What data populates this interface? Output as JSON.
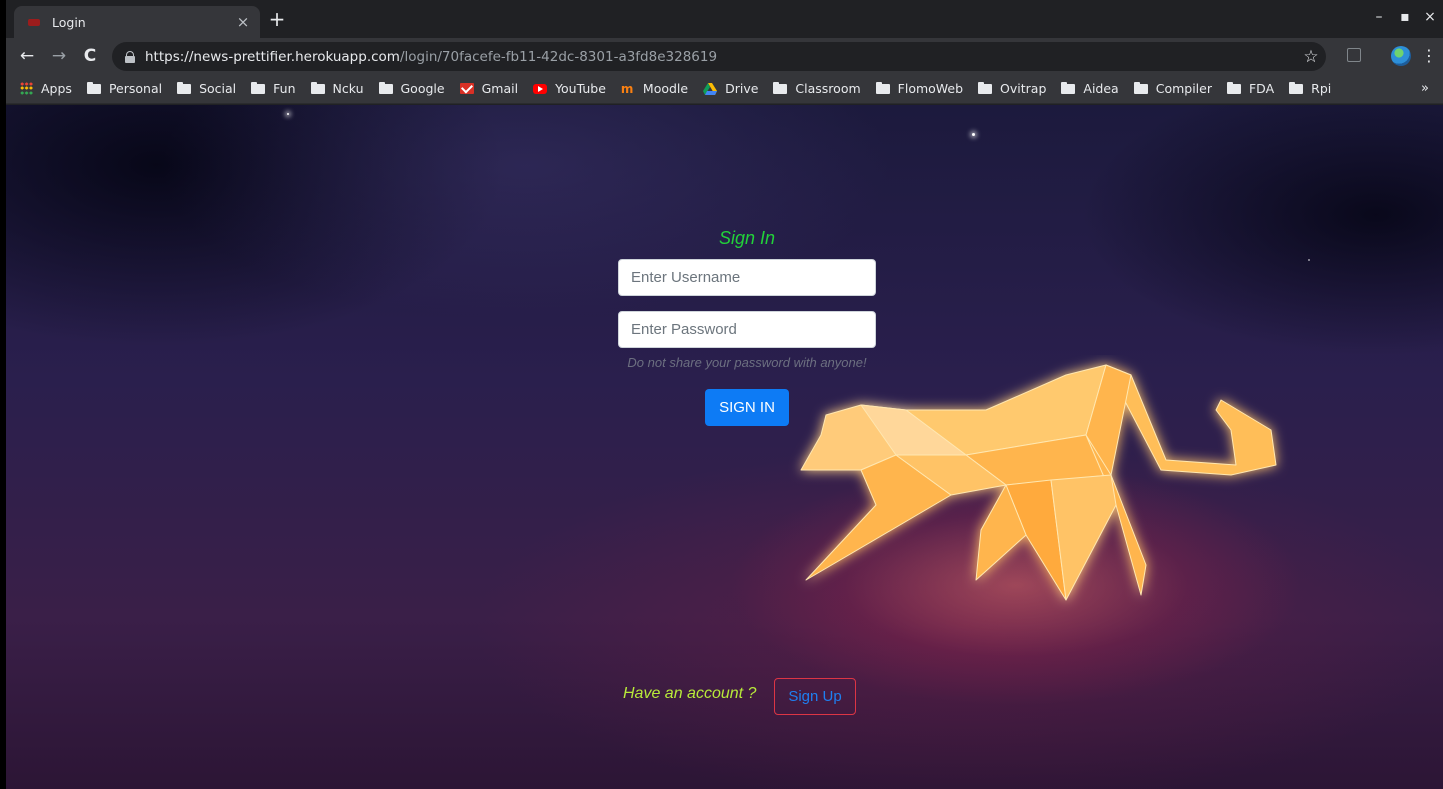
{
  "browser": {
    "tab": {
      "title": "Login",
      "close": "×"
    },
    "new_tab": "+",
    "window_controls": {
      "minimize": "–",
      "maximize": "▪",
      "close": "×"
    },
    "nav": {
      "back": "←",
      "forward": "→",
      "reload": "C"
    },
    "url": {
      "scheme": "https://",
      "host": "news-prettifier.herokuapp.com",
      "path": "/login/70facefe-fb11-42dc-8301-a3fd8e328619"
    },
    "bookmark_star": "☆",
    "menu": "⋮",
    "bookmarks": [
      {
        "label": "Apps",
        "icon": "apps-grid-icon"
      },
      {
        "label": "Personal",
        "icon": "folder-icon"
      },
      {
        "label": "Social",
        "icon": "folder-icon"
      },
      {
        "label": "Fun",
        "icon": "folder-icon"
      },
      {
        "label": "Ncku",
        "icon": "folder-icon"
      },
      {
        "label": "Google",
        "icon": "folder-icon"
      },
      {
        "label": "Gmail",
        "icon": "gmail-icon"
      },
      {
        "label": "YouTube",
        "icon": "youtube-icon"
      },
      {
        "label": "Moodle",
        "icon": "moodle-icon"
      },
      {
        "label": "Drive",
        "icon": "drive-icon"
      },
      {
        "label": "Classroom",
        "icon": "folder-icon"
      },
      {
        "label": "FlomoWeb",
        "icon": "folder-icon"
      },
      {
        "label": "Ovitrap",
        "icon": "folder-icon"
      },
      {
        "label": "Aidea",
        "icon": "folder-icon"
      },
      {
        "label": "Compiler",
        "icon": "folder-icon"
      },
      {
        "label": "FDA",
        "icon": "folder-icon"
      },
      {
        "label": "Rpi",
        "icon": "folder-icon"
      }
    ],
    "bookmarks_overflow": "»"
  },
  "login": {
    "title": "Sign In",
    "username_placeholder": "Enter Username",
    "password_placeholder": "Enter Password",
    "password_hint": "Do not share your password with anyone!",
    "signin_label": "SIGN IN",
    "have_account": "Have an account ?",
    "signup_label": "Sign Up"
  },
  "colors": {
    "title_green": "#22d13a",
    "primary_blue": "#0d7bf5",
    "account_text": "#b8ea3a",
    "signup_border": "#dc3545",
    "cat_orange": "#ffbe58"
  }
}
